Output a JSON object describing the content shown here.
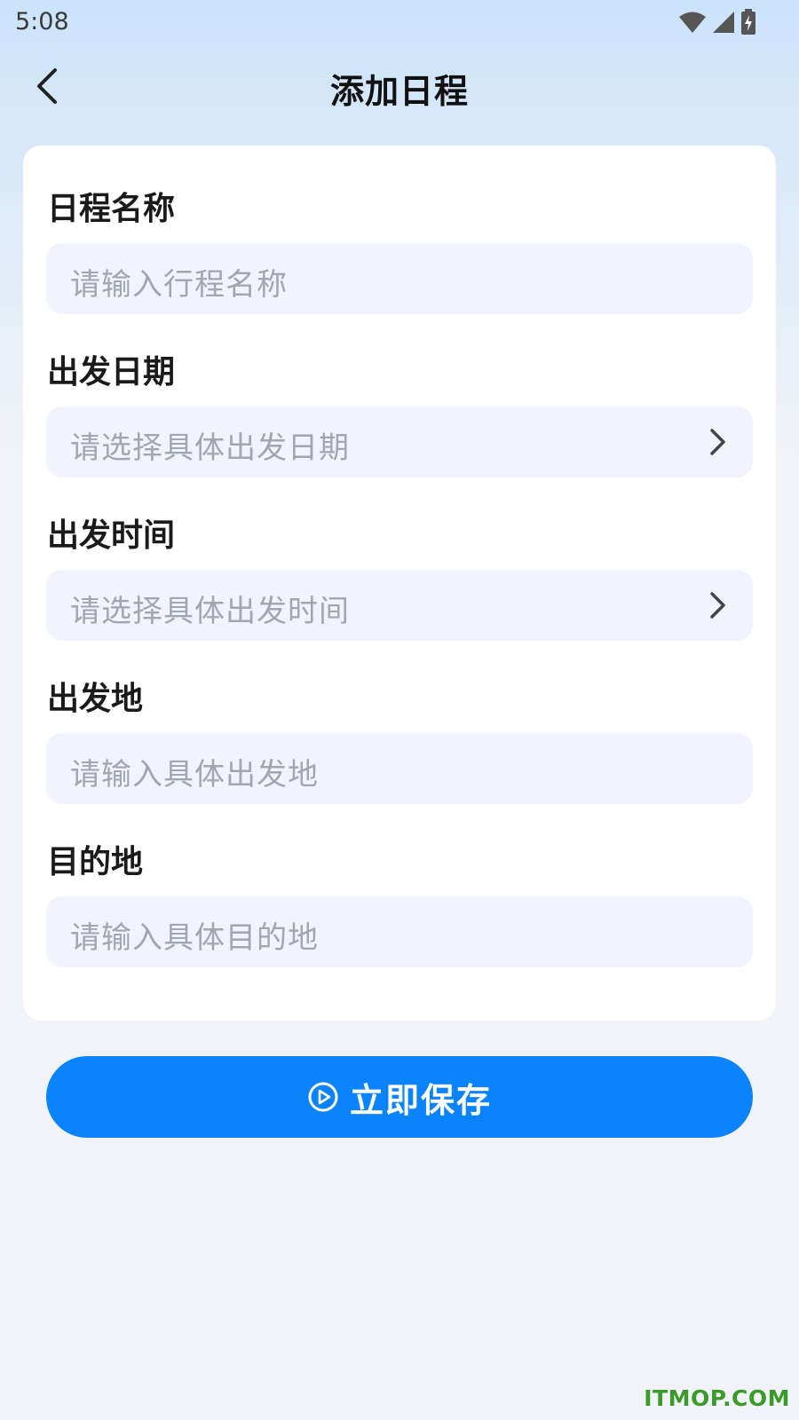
{
  "status_bar": {
    "time": "5:08"
  },
  "header": {
    "title": "添加日程",
    "back_icon": "chevron-left-icon"
  },
  "form": {
    "fields": [
      {
        "label": "日程名称",
        "placeholder": "请输入行程名称",
        "has_chevron": false
      },
      {
        "label": "出发日期",
        "placeholder": "请选择具体出发日期",
        "has_chevron": true
      },
      {
        "label": "出发时间",
        "placeholder": "请选择具体出发时间",
        "has_chevron": true
      },
      {
        "label": "出发地",
        "placeholder": "请输入具体出发地",
        "has_chevron": false
      },
      {
        "label": "目的地",
        "placeholder": "请输入具体目的地",
        "has_chevron": false
      }
    ]
  },
  "save_button": {
    "label": "立即保存",
    "icon": "play-circle-icon",
    "color": "#0b83fb"
  },
  "watermark": "ITMOP.COM",
  "colors": {
    "accent": "#0b83fb",
    "field_bg": "#f1f4ff",
    "placeholder": "#a2a6b0"
  }
}
